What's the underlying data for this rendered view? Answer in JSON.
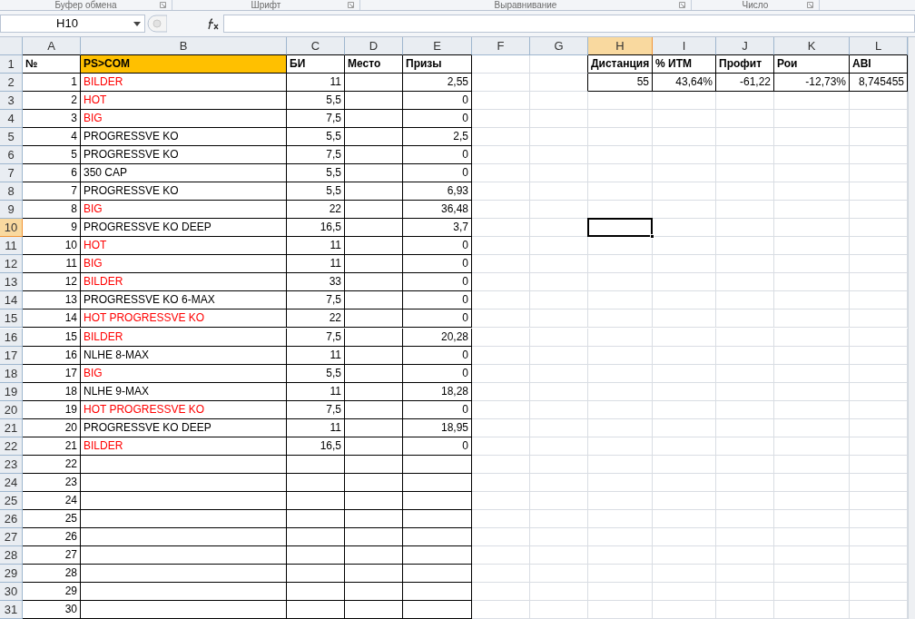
{
  "ribbon_groups": [
    "Буфер обмена",
    "Шрифт",
    "Выравнивание",
    "Число"
  ],
  "formula_bar": {
    "name_box": "H10"
  },
  "columns": [
    {
      "label": "A",
      "selected": false
    },
    {
      "label": "B",
      "selected": false
    },
    {
      "label": "C",
      "selected": false
    },
    {
      "label": "D",
      "selected": false
    },
    {
      "label": "E",
      "selected": false
    },
    {
      "label": "F",
      "selected": false
    },
    {
      "label": "G",
      "selected": false
    },
    {
      "label": "H",
      "selected": true
    },
    {
      "label": "I",
      "selected": false
    },
    {
      "label": "J",
      "selected": false
    },
    {
      "label": "K",
      "selected": false
    },
    {
      "label": "L",
      "selected": false
    }
  ],
  "row_headers": [
    {
      "label": "1",
      "selected": false
    },
    {
      "label": "2",
      "selected": false
    },
    {
      "label": "3",
      "selected": false
    },
    {
      "label": "4",
      "selected": false
    },
    {
      "label": "5",
      "selected": false
    },
    {
      "label": "6",
      "selected": false
    },
    {
      "label": "7",
      "selected": false
    },
    {
      "label": "8",
      "selected": false
    },
    {
      "label": "9",
      "selected": false
    },
    {
      "label": "10",
      "selected": true
    },
    {
      "label": "11",
      "selected": false
    },
    {
      "label": "12",
      "selected": false
    },
    {
      "label": "13",
      "selected": false
    },
    {
      "label": "14",
      "selected": false
    },
    {
      "label": "15",
      "selected": false
    },
    {
      "label": "16",
      "selected": false
    },
    {
      "label": "17",
      "selected": false
    },
    {
      "label": "18",
      "selected": false
    },
    {
      "label": "19",
      "selected": false
    },
    {
      "label": "20",
      "selected": false
    },
    {
      "label": "21",
      "selected": false
    },
    {
      "label": "22",
      "selected": false
    },
    {
      "label": "23",
      "selected": false
    },
    {
      "label": "24",
      "selected": false
    },
    {
      "label": "25",
      "selected": false
    },
    {
      "label": "26",
      "selected": false
    },
    {
      "label": "27",
      "selected": false
    },
    {
      "label": "28",
      "selected": false
    },
    {
      "label": "29",
      "selected": false
    },
    {
      "label": "30",
      "selected": false
    },
    {
      "label": "31",
      "selected": false
    }
  ],
  "table": {
    "header": [
      {
        "text": "№"
      },
      {
        "text": "PS>COM",
        "color": "#ffc000"
      },
      {
        "text": "БИ"
      },
      {
        "text": "Место"
      },
      {
        "text": "Призы"
      }
    ],
    "rows": [
      {
        "number": "1",
        "name": "BILDER",
        "color": "#ff0000",
        "buy_in": "11",
        "prize": "2,55"
      },
      {
        "number": "2",
        "name": "HOT",
        "color": "#ff0000",
        "buy_in": "5,5",
        "prize": "0"
      },
      {
        "number": "3",
        "name": "BIG",
        "color": "#ff0000",
        "buy_in": "7,5",
        "prize": "0"
      },
      {
        "number": "4",
        "name": "PROGRESSVE KO",
        "color": "#000000",
        "buy_in": "5,5",
        "prize": "2,5"
      },
      {
        "number": "5",
        "name": "PROGRESSVE KO",
        "color": "#000000",
        "buy_in": "7,5",
        "prize": "0"
      },
      {
        "number": "6",
        "name": "350 CAP",
        "color": "#000000",
        "buy_in": "5,5",
        "prize": "0"
      },
      {
        "number": "7",
        "name": "PROGRESSVE KO",
        "color": "#000000",
        "buy_in": "5,5",
        "prize": "6,93"
      },
      {
        "number": "8",
        "name": "BIG",
        "color": "#ff0000",
        "buy_in": "22",
        "prize": "36,48"
      },
      {
        "number": "9",
        "name": "PROGRESSVE KO DEEP",
        "color": "#000000",
        "buy_in": "16,5",
        "prize": "3,7"
      },
      {
        "number": "10",
        "name": "HOT",
        "color": "#ff0000",
        "buy_in": "11",
        "prize": "0"
      },
      {
        "number": "11",
        "name": "BIG",
        "color": "#ff0000",
        "buy_in": "11",
        "prize": "0"
      },
      {
        "number": "12",
        "name": "BILDER",
        "color": "#ff0000",
        "buy_in": "33",
        "prize": "0"
      },
      {
        "number": "13",
        "name": "PROGRESSVE KO 6-MAX",
        "color": "#000000",
        "buy_in": "7,5",
        "prize": "0"
      },
      {
        "number": "14",
        "name": "HOT PROGRESSVE KO",
        "color": "#ff0000",
        "buy_in": "22",
        "prize": "0"
      },
      {
        "number": "15",
        "name": "BILDER",
        "color": "#ff0000",
        "buy_in": "7,5",
        "prize": "20,28"
      },
      {
        "number": "16",
        "name": "NLHE 8-MAX",
        "color": "#000000",
        "buy_in": "11",
        "prize": "0"
      },
      {
        "number": "17",
        "name": "BIG",
        "color": "#ff0000",
        "buy_in": "5,5",
        "prize": "0"
      },
      {
        "number": "18",
        "name": "NLHE 9-MAX",
        "color": "#000000",
        "buy_in": "11",
        "prize": "18,28"
      },
      {
        "number": "19",
        "name": "HOT PROGRESSVE KO",
        "color": "#ff0000",
        "buy_in": "7,5",
        "prize": "0"
      },
      {
        "number": "20",
        "name": "PROGRESSVE KO DEEP",
        "color": "#000000",
        "buy_in": "11",
        "prize": "18,95"
      },
      {
        "number": "21",
        "name": "BILDER",
        "color": "#ff0000",
        "buy_in": "16,5",
        "prize": "0"
      },
      {
        "number": "22"
      },
      {
        "number": "23"
      },
      {
        "number": "24"
      },
      {
        "number": "25"
      },
      {
        "number": "26"
      },
      {
        "number": "27"
      },
      {
        "number": "28"
      },
      {
        "number": "29"
      },
      {
        "number": "30"
      }
    ]
  },
  "summary": {
    "header": [
      "Дистанция",
      "% ИТМ",
      "Профит",
      "Рои",
      "ABI"
    ],
    "values": [
      "55",
      "43,64%",
      "-61,22",
      "-12,73%",
      "8,745455"
    ]
  }
}
